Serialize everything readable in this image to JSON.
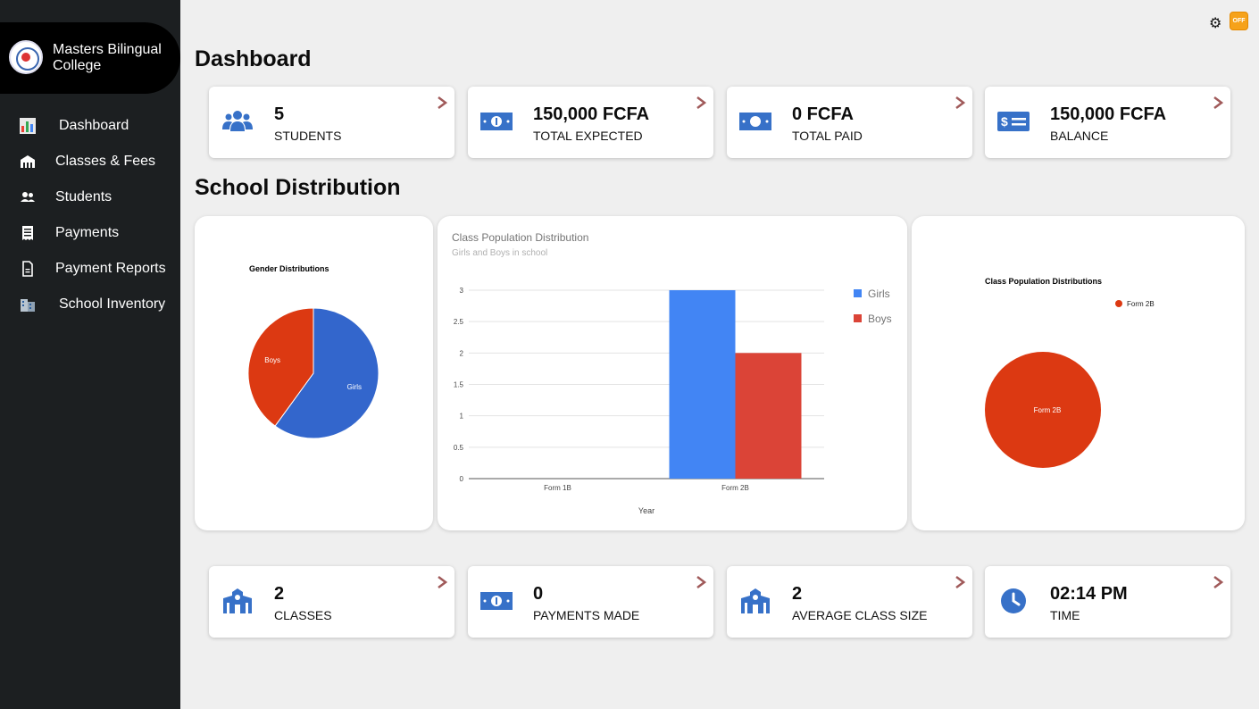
{
  "brand": {
    "name": "Masters Bilingual College"
  },
  "sidebar": {
    "items": [
      {
        "label": "Dashboard",
        "icon": "bar-chart-icon"
      },
      {
        "label": "Classes & Fees",
        "icon": "school-icon"
      },
      {
        "label": "Students",
        "icon": "users-icon"
      },
      {
        "label": "Payments",
        "icon": "receipt-icon"
      },
      {
        "label": "Payment Reports",
        "icon": "file-icon"
      },
      {
        "label": "School Inventory",
        "icon": "building-icon"
      }
    ]
  },
  "topbar": {
    "toggle_label": "OFF"
  },
  "headings": {
    "dashboard": "Dashboard",
    "distribution": "School Distribution"
  },
  "top_cards": [
    {
      "value": "5",
      "caption": "STUDENTS",
      "icon": "users-icon"
    },
    {
      "value": "150,000 FCFA",
      "caption": "TOTAL EXPECTED",
      "icon": "money-bill-icon"
    },
    {
      "value": "0 FCFA",
      "caption": "TOTAL PAID",
      "icon": "money-bill-icon"
    },
    {
      "value": "150,000 FCFA",
      "caption": "BALANCE",
      "icon": "check-icon"
    }
  ],
  "bottom_cards": [
    {
      "value": "2",
      "caption": "CLASSES",
      "icon": "school-icon"
    },
    {
      "value": "0",
      "caption": "PAYMENTS MADE",
      "icon": "money-bill-icon"
    },
    {
      "value": "2",
      "caption": "AVERAGE CLASS SIZE",
      "icon": "school-icon"
    },
    {
      "value": "02:14 PM",
      "caption": "TIME",
      "icon": "clock-icon"
    }
  ],
  "colors": {
    "accent_blue": "#3771c8",
    "arrow": "#a05a5a",
    "girls_bar": "#4285f4",
    "boys_bar": "#db4437",
    "pie_blue": "#3366cc",
    "pie_red": "#dc3912"
  },
  "chart_data": [
    {
      "type": "pie",
      "title": "Gender Distributions",
      "labels": [
        "Girls",
        "Boys"
      ],
      "values": [
        3,
        2
      ]
    },
    {
      "type": "bar",
      "title": "Class Population Distribution",
      "subtitle": "Girls and Boys in school",
      "xlabel": "Year",
      "ylabel": "",
      "categories": [
        "Form 1B",
        "Form 2B"
      ],
      "series": [
        {
          "name": "Girls",
          "values": [
            0,
            3
          ]
        },
        {
          "name": "Boys",
          "values": [
            0,
            2
          ]
        }
      ],
      "ylim": [
        0,
        3
      ],
      "yticks": [
        "0",
        "0.5",
        "1",
        "1.5",
        "2",
        "2.5",
        "3"
      ],
      "grid": true,
      "legend": "right"
    },
    {
      "type": "pie",
      "title": "Class Population Distributions",
      "labels": [
        "Form 2B"
      ],
      "values": [
        5
      ],
      "legend": "top-right"
    }
  ]
}
